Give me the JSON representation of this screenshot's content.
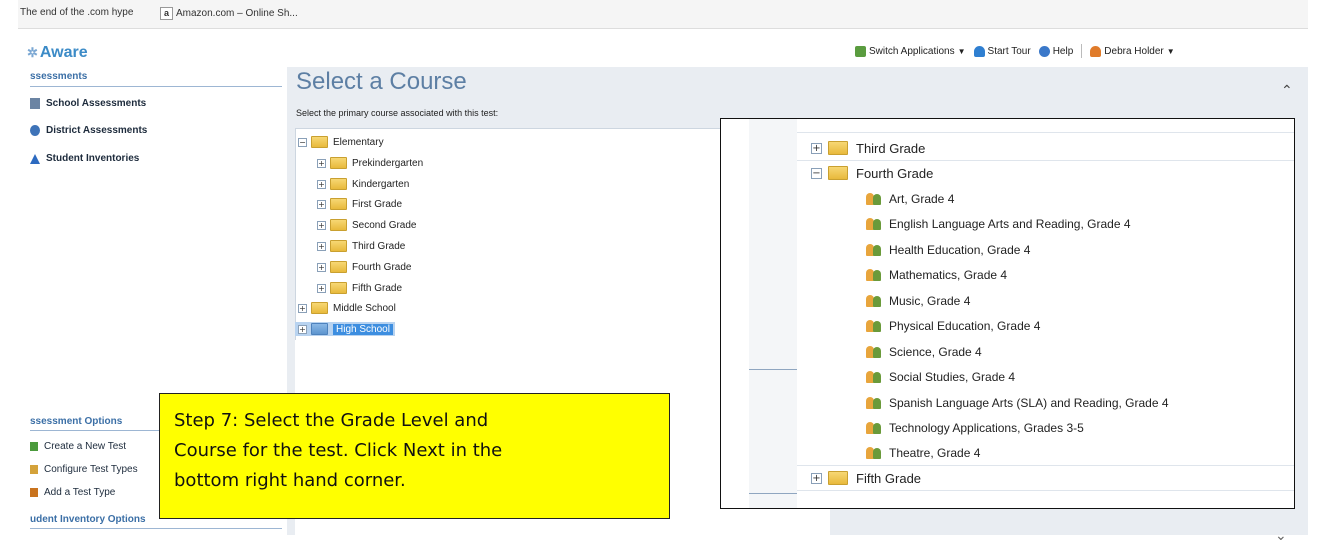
{
  "browser": {
    "bookmarks": [
      {
        "label": "The end of the .com hype"
      },
      {
        "label": "Amazon.com – Online Sh..."
      }
    ]
  },
  "app": {
    "logo_text": "Aware",
    "topnav": {
      "switch_apps": "Switch Applications",
      "start_tour": "Start Tour",
      "help": "Help",
      "user": "Debra Holder"
    }
  },
  "sidebar": {
    "assessments_header": "ssessments",
    "items": [
      {
        "label": "School Assessments",
        "icon": "building-icon"
      },
      {
        "label": "District Assessments",
        "icon": "globe-icon"
      },
      {
        "label": "Student Inventories",
        "icon": "triangle-icon"
      }
    ],
    "options_header": "ssessment Options",
    "options": [
      {
        "label": "Create a New Test"
      },
      {
        "label": "Configure Test Types"
      },
      {
        "label": "Add a Test Type"
      }
    ],
    "inventory_header": "udent Inventory Options"
  },
  "main": {
    "title": "Select a Course",
    "subtitle": "Select the primary course associated with this test:",
    "tree": [
      {
        "label": "Elementary",
        "toggle": "−"
      },
      {
        "label": "Prekindergarten",
        "toggle": "+"
      },
      {
        "label": "Kindergarten",
        "toggle": "+"
      },
      {
        "label": "First Grade",
        "toggle": "+"
      },
      {
        "label": "Second Grade",
        "toggle": "+"
      },
      {
        "label": "Third Grade",
        "toggle": "+"
      },
      {
        "label": "Fourth Grade",
        "toggle": "+"
      },
      {
        "label": "Fifth Grade",
        "toggle": "+"
      },
      {
        "label": "Middle School",
        "toggle": "+"
      },
      {
        "label": "High School",
        "toggle": "+"
      }
    ]
  },
  "zoom": {
    "grades": [
      {
        "label": "Third Grade",
        "toggle": "+"
      },
      {
        "label": "Fourth Grade",
        "toggle": "−"
      },
      {
        "label": "Fifth Grade",
        "toggle": "+"
      }
    ],
    "courses": [
      "Art, Grade 4",
      "English Language Arts and Reading, Grade 4",
      "Health Education, Grade 4",
      "Mathematics, Grade 4",
      "Music, Grade 4",
      "Physical Education, Grade 4",
      "Science, Grade 4",
      "Social Studies, Grade 4",
      "Spanish Language Arts (SLA) and Reading, Grade 4",
      "Technology Applications, Grades 3-5",
      "Theatre, Grade 4"
    ]
  },
  "callout": {
    "line1": "Step 7:  Select the Grade Level and",
    "line2": "Course for the test.  Click Next in the",
    "line3": "bottom right hand corner."
  },
  "colors": {
    "accent": "#3c8bc7",
    "title": "#5d7fa4",
    "callout_bg": "#ffff00",
    "selection": "#3d8ee0"
  }
}
